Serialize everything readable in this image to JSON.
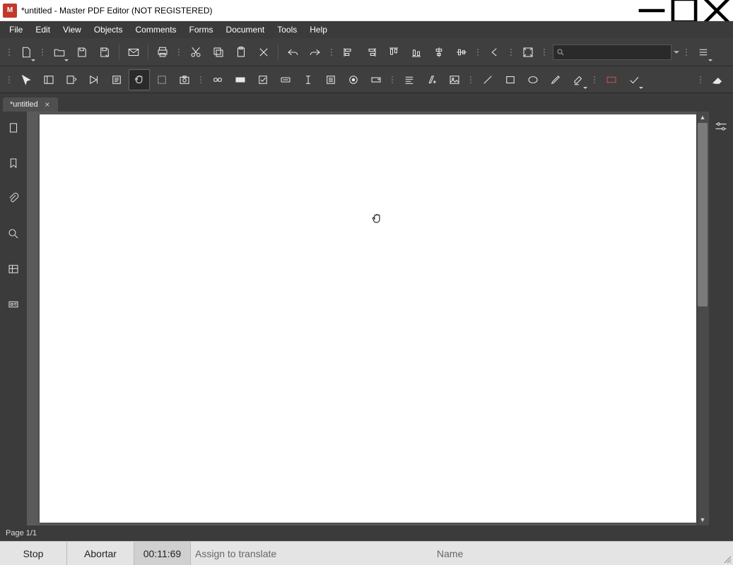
{
  "titlebar": {
    "title": "*untitled - Master PDF Editor (NOT REGISTERED)"
  },
  "menu": {
    "file": "File",
    "edit": "Edit",
    "view": "View",
    "objects": "Objects",
    "comments": "Comments",
    "forms": "Forms",
    "document": "Document",
    "tools": "Tools",
    "help": "Help"
  },
  "tab": {
    "label": "*untitled"
  },
  "search": {
    "value": ""
  },
  "status": {
    "page": "Page 1/1"
  },
  "bottom": {
    "stop": "Stop",
    "abort": "Abortar",
    "timer": "00:11:69",
    "assign": "Assign to translate",
    "name": "Name"
  }
}
